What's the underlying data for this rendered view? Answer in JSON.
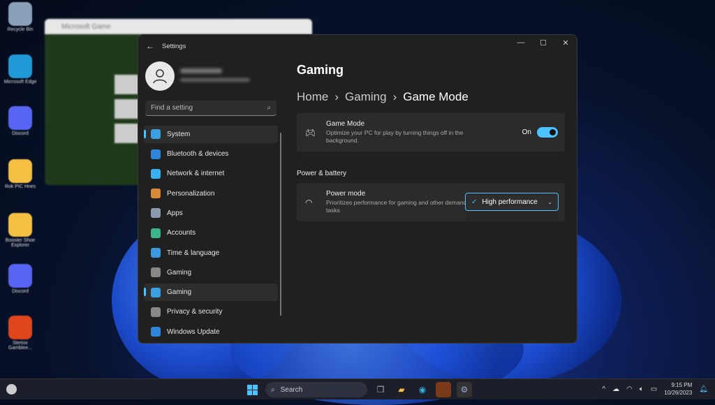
{
  "desktop": {
    "icons": [
      {
        "label": "Recycle Bin",
        "color": "#8aa0b8"
      },
      {
        "label": "Microsoft Edge",
        "color": "#1f9ad6"
      },
      {
        "label": "Discord",
        "color": "#5865f2"
      },
      {
        "label": "Rok PIC Hnes",
        "color": "#f5c042"
      },
      {
        "label": "Booster Shoe Explorer",
        "color": "#f5c042"
      },
      {
        "label": "Discord",
        "color": "#5865f2"
      },
      {
        "label": "Steriox Gamblee...",
        "color": "#e0461c"
      }
    ]
  },
  "background_window": {
    "title": "Microsoft Game"
  },
  "settings": {
    "title": "Settings",
    "search_placeholder": "Find a setting",
    "nav": [
      {
        "label": "System",
        "icon": "monitor-icon",
        "color": "#3aa0e0",
        "active": true
      },
      {
        "label": "Bluetooth & devices",
        "icon": "bluetooth-icon",
        "color": "#2f86d9"
      },
      {
        "label": "Network & internet",
        "icon": "wifi-icon",
        "color": "#3ab0f0"
      },
      {
        "label": "Personalization",
        "icon": "brush-icon",
        "color": "#d68a3a"
      },
      {
        "label": "Apps",
        "icon": "apps-icon",
        "color": "#8a9ab0"
      },
      {
        "label": "Accounts",
        "icon": "person-icon",
        "color": "#3ab58a"
      },
      {
        "label": "Time & language",
        "icon": "globe-icon",
        "color": "#3a9ae0"
      },
      {
        "label": "Gaming",
        "icon": "controller-icon",
        "color": "#888"
      },
      {
        "label": "Gaming",
        "icon": "accessibility-icon",
        "color": "#3aa0e0",
        "active": true
      },
      {
        "label": "Privacy & security",
        "icon": "shield-icon",
        "color": "#888"
      },
      {
        "label": "Windows Update",
        "icon": "update-icon",
        "color": "#2f86d9"
      }
    ],
    "page_title": "Gaming",
    "breadcrumb": [
      "Home",
      "Gaming",
      "Game Mode"
    ],
    "game_mode": {
      "title": "Game Mode",
      "desc": "Optimize your PC for play by turning things off in the background.",
      "state": "On",
      "enabled": true
    },
    "section": "Power & battery",
    "power_mode": {
      "title": "Power mode",
      "desc": "Prioritizes performance for gaming and other demanding tasks",
      "value": "High performance"
    }
  },
  "taskbar": {
    "search": "Search",
    "time": "9:15 PM",
    "date": "10/26/2023"
  }
}
